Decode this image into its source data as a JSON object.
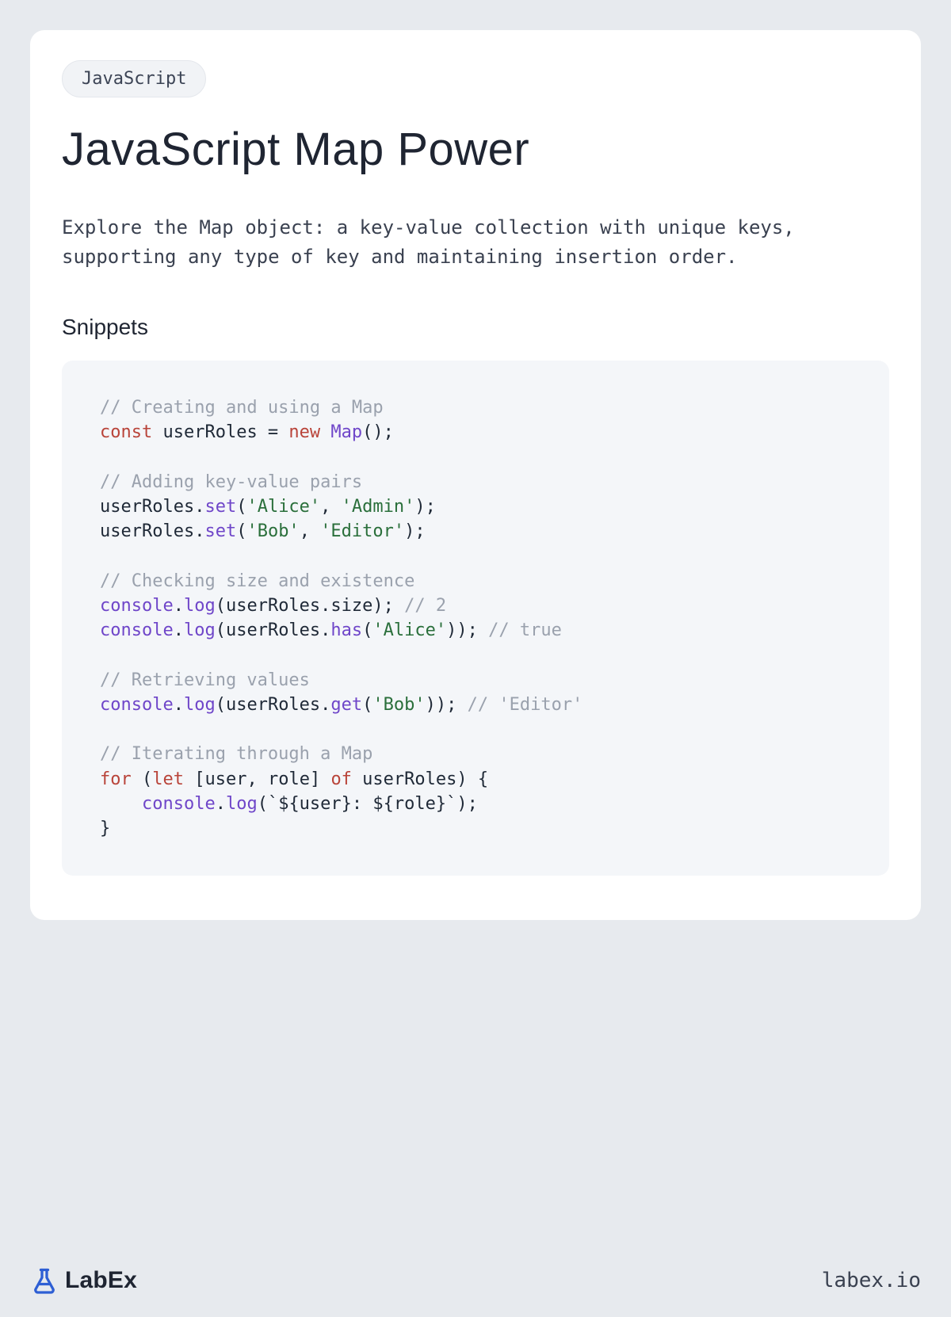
{
  "badge": "JavaScript",
  "title": "JavaScript Map Power",
  "description": "Explore the Map object: a key-value collection with unique keys, supporting any type of key and maintaining insertion order.",
  "section_heading": "Snippets",
  "code": {
    "lines": [
      [
        {
          "t": "comment",
          "v": "// Creating and using a Map"
        }
      ],
      [
        {
          "t": "keyword",
          "v": "const"
        },
        {
          "t": "plain",
          "v": " userRoles = "
        },
        {
          "t": "keyword",
          "v": "new"
        },
        {
          "t": "plain",
          "v": " "
        },
        {
          "t": "class",
          "v": "Map"
        },
        {
          "t": "plain",
          "v": "();"
        }
      ],
      [],
      [
        {
          "t": "comment",
          "v": "// Adding key-value pairs"
        }
      ],
      [
        {
          "t": "plain",
          "v": "userRoles."
        },
        {
          "t": "func",
          "v": "set"
        },
        {
          "t": "plain",
          "v": "("
        },
        {
          "t": "string",
          "v": "'Alice'"
        },
        {
          "t": "plain",
          "v": ", "
        },
        {
          "t": "string",
          "v": "'Admin'"
        },
        {
          "t": "plain",
          "v": ");"
        }
      ],
      [
        {
          "t": "plain",
          "v": "userRoles."
        },
        {
          "t": "func",
          "v": "set"
        },
        {
          "t": "plain",
          "v": "("
        },
        {
          "t": "string",
          "v": "'Bob'"
        },
        {
          "t": "plain",
          "v": ", "
        },
        {
          "t": "string",
          "v": "'Editor'"
        },
        {
          "t": "plain",
          "v": ");"
        }
      ],
      [],
      [
        {
          "t": "comment",
          "v": "// Checking size and existence"
        }
      ],
      [
        {
          "t": "builtin",
          "v": "console"
        },
        {
          "t": "plain",
          "v": "."
        },
        {
          "t": "func",
          "v": "log"
        },
        {
          "t": "plain",
          "v": "(userRoles.size); "
        },
        {
          "t": "comment",
          "v": "// 2"
        }
      ],
      [
        {
          "t": "builtin",
          "v": "console"
        },
        {
          "t": "plain",
          "v": "."
        },
        {
          "t": "func",
          "v": "log"
        },
        {
          "t": "plain",
          "v": "(userRoles."
        },
        {
          "t": "func",
          "v": "has"
        },
        {
          "t": "plain",
          "v": "("
        },
        {
          "t": "string",
          "v": "'Alice'"
        },
        {
          "t": "plain",
          "v": ")); "
        },
        {
          "t": "comment",
          "v": "// true"
        }
      ],
      [],
      [
        {
          "t": "comment",
          "v": "// Retrieving values"
        }
      ],
      [
        {
          "t": "builtin",
          "v": "console"
        },
        {
          "t": "plain",
          "v": "."
        },
        {
          "t": "func",
          "v": "log"
        },
        {
          "t": "plain",
          "v": "(userRoles."
        },
        {
          "t": "func",
          "v": "get"
        },
        {
          "t": "plain",
          "v": "("
        },
        {
          "t": "string",
          "v": "'Bob'"
        },
        {
          "t": "plain",
          "v": ")); "
        },
        {
          "t": "comment",
          "v": "// 'Editor'"
        }
      ],
      [],
      [
        {
          "t": "comment",
          "v": "// Iterating through a Map"
        }
      ],
      [
        {
          "t": "keyword",
          "v": "for"
        },
        {
          "t": "plain",
          "v": " ("
        },
        {
          "t": "keyword",
          "v": "let"
        },
        {
          "t": "plain",
          "v": " [user, role] "
        },
        {
          "t": "keyword",
          "v": "of"
        },
        {
          "t": "plain",
          "v": " userRoles) {"
        }
      ],
      [
        {
          "t": "plain",
          "v": "    "
        },
        {
          "t": "builtin",
          "v": "console"
        },
        {
          "t": "plain",
          "v": "."
        },
        {
          "t": "func",
          "v": "log"
        },
        {
          "t": "plain",
          "v": "(`${user}: ${role}`);"
        }
      ],
      [
        {
          "t": "plain",
          "v": "}"
        }
      ]
    ]
  },
  "footer": {
    "brand": "LabEx",
    "site": "labex.io"
  }
}
